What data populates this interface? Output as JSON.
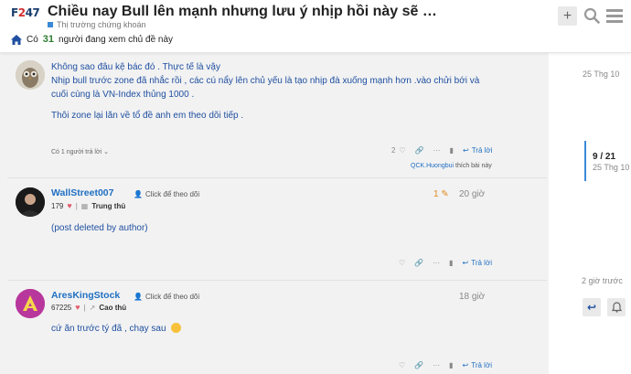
{
  "header": {
    "logo_text": "F247",
    "title": "Chiều nay Bull lên mạnh nhưng lưu ý nhịp hồi này sẽ …",
    "category": "Thị trường chứng khoán",
    "viewers_prefix": "Có",
    "viewers_count": "31",
    "viewers_suffix": "người đang xem chủ đề này"
  },
  "posts": [
    {
      "body": [
        "Không sao đâu kệ bác đó . Thực tế là vậy",
        "Nhịp bull trước zone đã nhắc rồi , các cú nẩy lên chủ yếu là tạo nhịp đà xuống mạnh hơn .vào chửi bới và",
        "cuối cùng là VN-Index thủng 1000 .",
        "Thôi zone lại lăn về tổ đề anh em theo dõi tiếp ."
      ],
      "replies_link": "Có 1 người trả lời",
      "likes": "2",
      "reply_label": "Trả lời",
      "liked_by_user": "QCK.Huongbui",
      "liked_by_suffix": "thích bài này"
    },
    {
      "username": "WallStreet007",
      "follow": "Click để theo dõi",
      "points": "179",
      "rank": "Trung thủ",
      "edits": "1",
      "time": "20 giờ",
      "body": [
        "(post deleted by author)"
      ],
      "reply_label": "Trả lời"
    },
    {
      "username": "AresKingStock",
      "follow": "Click để theo dõi",
      "points": "67225",
      "rank": "Cao thủ",
      "time": "18 giờ",
      "body": [
        "cứ ăn trước tý đã , chạy sau"
      ],
      "reply_label": "Trả lời"
    }
  ],
  "timeline": {
    "top_date": "25 Thg 10",
    "position": "9 / 21",
    "current_date": "25 Thg 10",
    "bottom_date": "2 giờ trước"
  },
  "colors": {
    "accent": "#1f6fc2",
    "timeline": "#3a89d6",
    "heart": "#e05a6c",
    "edit": "#e08a1f"
  }
}
